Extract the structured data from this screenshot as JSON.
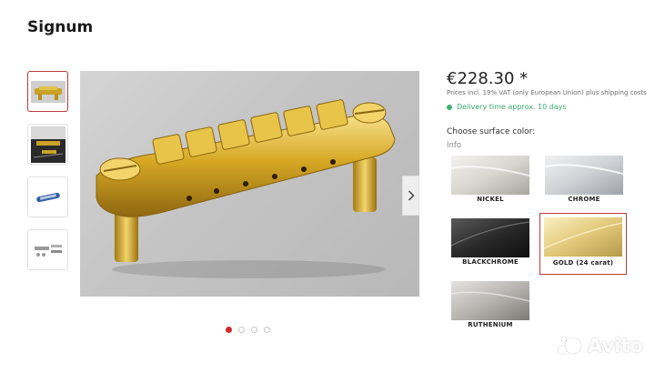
{
  "page": {
    "title": "Signum"
  },
  "gallery": {
    "thumbnails": [
      {
        "name": "bridge-gold-front"
      },
      {
        "name": "bridge-on-guitar"
      },
      {
        "name": "bridge-blue-detail"
      },
      {
        "name": "bridge-parts-set"
      }
    ],
    "active_index": 0,
    "slide_count": 4
  },
  "product": {
    "price": "€228.30 *",
    "vat_note": "Prices incl. 19% VAT (only European Union) plus shipping costs",
    "delivery": "Delivery time approx. 10 days",
    "surface_heading": "Choose surface color:",
    "info_label": "Info"
  },
  "colors": {
    "options": [
      {
        "label": "NICKEL"
      },
      {
        "label": "CHROME"
      },
      {
        "label": "BLACKCHROME"
      },
      {
        "label": "GOLD (24 carat)"
      },
      {
        "label": "RUTHENIUM"
      }
    ],
    "selected": "GOLD (24 carat)",
    "accent": "#c0393b",
    "delivery_green": "#3cb371"
  },
  "watermark": {
    "text": "Avito"
  }
}
